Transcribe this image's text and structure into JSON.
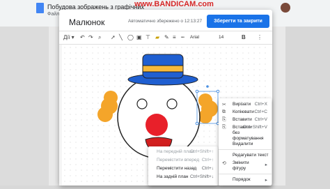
{
  "watermark": "www.BANDICAM.com",
  "doc": {
    "title": "Побудова зображень з графічних",
    "subtitle": "Файл"
  },
  "dialog": {
    "title": "Малюнок",
    "autosave": "Автоматично збережено о 12:13:27",
    "save_button": "Зберегти та закрити"
  },
  "toolbar": {
    "font": "Arial",
    "size": "14",
    "undo": "↶",
    "redo": "↷",
    "zoom": "⌕"
  },
  "context_menu": {
    "items": [
      {
        "icon": "✂",
        "label": "Вирізати",
        "shortcut": "Ctrl+X"
      },
      {
        "icon": "⧉",
        "label": "Копіювати",
        "shortcut": "Ctrl+C"
      },
      {
        "icon": "⎘",
        "label": "Вставити",
        "shortcut": "Ctrl+V"
      },
      {
        "icon": "⎘",
        "label": "Вставити без форматування",
        "shortcut": "Ctrl+Shift+V"
      },
      {
        "icon": "",
        "label": "Видалити",
        "shortcut": ""
      },
      {
        "icon": "",
        "label": "Редагувати текст",
        "shortcut": ""
      },
      {
        "icon": "",
        "label": "Змінити фігуру",
        "shortcut": ""
      },
      {
        "icon": "",
        "label": "Порядок",
        "shortcut": ""
      }
    ]
  },
  "order_submenu": {
    "items": [
      {
        "label": "На передній план",
        "shortcut": "Ctrl+Shift+↑",
        "disabled": true
      },
      {
        "label": "Перемістити вперед",
        "shortcut": "Ctrl+↑",
        "disabled": true
      },
      {
        "label": "Перемістити назад",
        "shortcut": "Ctrl+↓",
        "disabled": false
      },
      {
        "label": "На задній план",
        "shortcut": "Ctrl+Shift+↓",
        "disabled": false
      }
    ]
  },
  "colors": {
    "hat_blue": "#1f5fd1",
    "hat_band": "#f6b93b",
    "hair": "#f4a52a",
    "nose": "#e8202a",
    "mouth": "#d21f1f",
    "accent": "#1a73e8"
  }
}
